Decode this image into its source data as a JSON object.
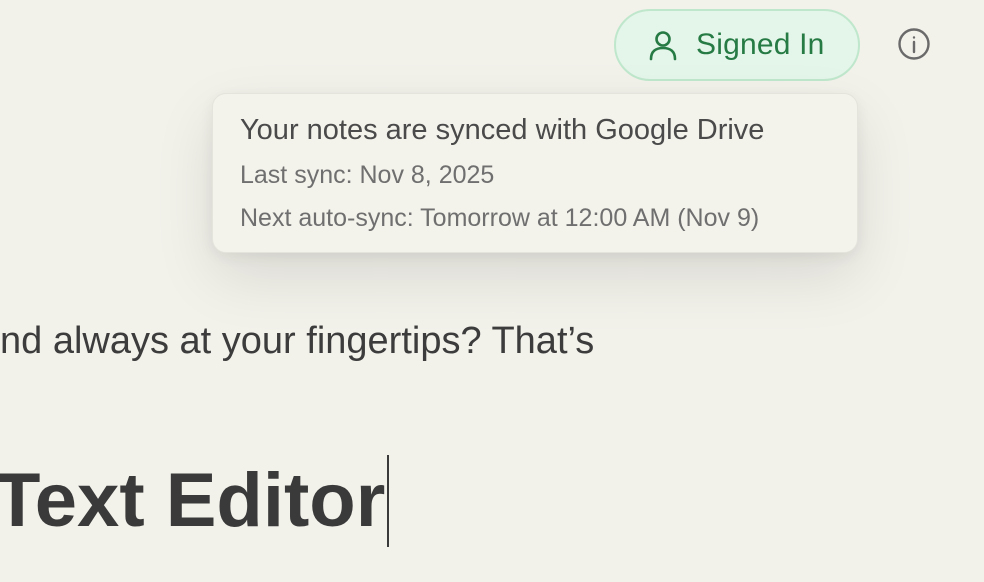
{
  "header": {
    "account_button_label": "Signed In",
    "account_icon": "user-icon",
    "info_icon": "info-icon",
    "accent_color": "#267a44"
  },
  "sync_tooltip": {
    "message": "Your notes are synced with Google Drive",
    "last_sync": "Last sync: Nov 8, 2025",
    "next_sync": "Next auto-sync: Tomorrow at 12:00 AM (Nov 9)"
  },
  "editor": {
    "body_text": "nd always at your fingertips? That’s",
    "heading_text": "Text Editor"
  }
}
